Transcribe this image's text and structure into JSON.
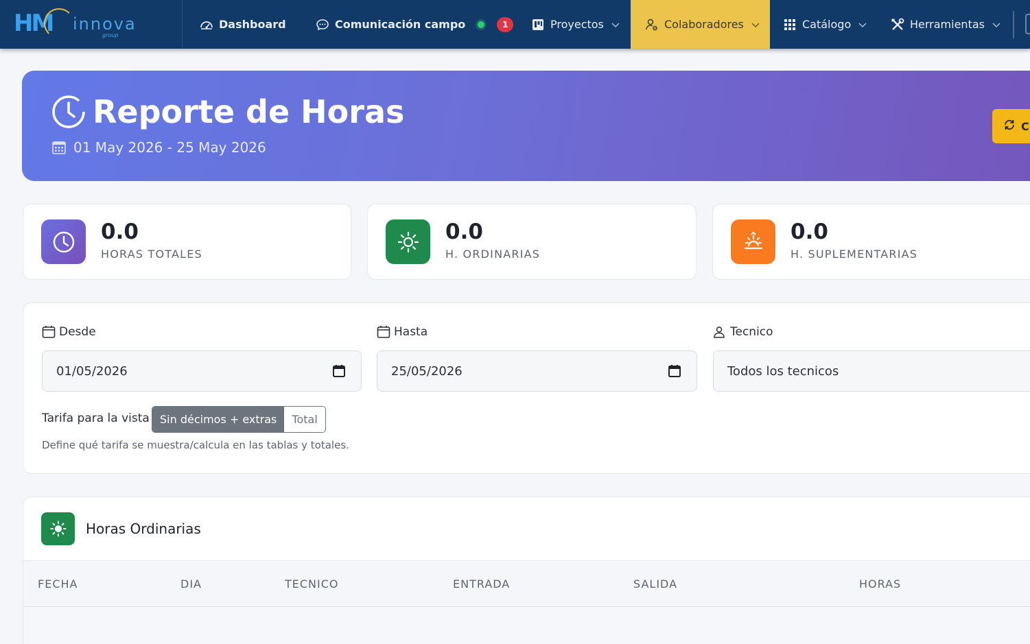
{
  "brand": {
    "logo_mark": "HM",
    "logo_text": "innova",
    "logo_sub": "group"
  },
  "nav": {
    "dashboard": "Dashboard",
    "comunicacion": "Comunicación campo",
    "comunicacion_badge": "1",
    "proyectos": "Proyectos",
    "colaboradores": "Colaboradores",
    "catalogo": "Catálogo",
    "herramientas": "Herramientas"
  },
  "hero": {
    "title": "Reporte de Horas",
    "date_range": "01 May 2026 - 25 May 2026",
    "button_label": "C"
  },
  "stats": [
    {
      "value": "0.0",
      "label": "HORAS TOTALES",
      "color": "#7256c4"
    },
    {
      "value": "0.0",
      "label": "H. ORDINARIAS",
      "color": "#1f8a4c"
    },
    {
      "value": "0.0",
      "label": "H. SUPLEMENTARIAS",
      "color": "#f97a1f"
    }
  ],
  "filters": {
    "desde_label": "Desde",
    "desde_value": "01/05/2026",
    "hasta_label": "Hasta",
    "hasta_value": "25/05/2026",
    "tecnico_label": "Tecnico",
    "tecnico_value": "Todos los tecnicos",
    "tarifa_label": "Tarifa para la vista",
    "tarifa_options": [
      "Sin décimos + extras",
      "Total"
    ],
    "tarifa_selected": "Sin décimos + extras",
    "help": "Define qué tarifa se muestra/calcula en las tablas y totales."
  },
  "table": {
    "title": "Horas Ordinarias",
    "columns": [
      "FECHA",
      "DIA",
      "TECNICO",
      "ENTRADA",
      "SALIDA",
      "HORAS"
    ]
  },
  "colors": {
    "navbar": "#123a68",
    "active_nav": "#ecc44b",
    "hero_start": "#6279e6",
    "hero_end": "#7457bd",
    "accent_button": "#f3b818"
  }
}
